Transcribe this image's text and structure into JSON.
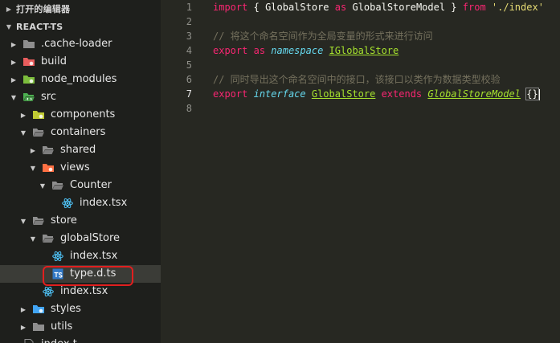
{
  "sidebar": {
    "open_editors": "打开的编辑器",
    "project": "REACT-TS",
    "tree": [
      {
        "label": ".cache-loader",
        "depth": 1,
        "arrow": "right",
        "icon": "folder-icon",
        "color": "#8e8e8e"
      },
      {
        "label": "build",
        "depth": 1,
        "arrow": "right",
        "icon": "folder-build-icon",
        "color": "#e85d5d"
      },
      {
        "label": "node_modules",
        "depth": 1,
        "arrow": "right",
        "icon": "folder-node-icon",
        "color": "#7cbd3c"
      },
      {
        "label": "src",
        "depth": 1,
        "arrow": "down",
        "icon": "folder-src-icon",
        "color": "#4caf50"
      },
      {
        "label": "components",
        "depth": 2,
        "arrow": "right",
        "icon": "folder-components-icon",
        "color": "#c0ca33"
      },
      {
        "label": "containers",
        "depth": 2,
        "arrow": "down",
        "icon": "folder-open-icon",
        "color": "#8e8e8e"
      },
      {
        "label": "shared",
        "depth": 3,
        "arrow": "right",
        "icon": "folder-open-icon",
        "color": "#8e8e8e"
      },
      {
        "label": "views",
        "depth": 3,
        "arrow": "down",
        "icon": "folder-views-icon",
        "color": "#ff7043"
      },
      {
        "label": "Counter",
        "depth": 4,
        "arrow": "down",
        "icon": "folder-open-icon",
        "color": "#8e8e8e"
      },
      {
        "label": "index.tsx",
        "depth": 5,
        "arrow": "none",
        "icon": "react-icon",
        "color": "#4fc3f7"
      },
      {
        "label": "store",
        "depth": 2,
        "arrow": "down",
        "icon": "folder-open-icon",
        "color": "#8e8e8e"
      },
      {
        "label": "globalStore",
        "depth": 3,
        "arrow": "down",
        "icon": "folder-open-icon",
        "color": "#8e8e8e"
      },
      {
        "label": "index.tsx",
        "depth": 4,
        "arrow": "none",
        "icon": "react-icon",
        "color": "#4fc3f7"
      },
      {
        "label": "type.d.ts",
        "depth": 4,
        "arrow": "none",
        "icon": "typescript-icon",
        "color": "#3178c6",
        "selected": true
      },
      {
        "label": "index.tsx",
        "depth": 3,
        "arrow": "none",
        "icon": "react-icon",
        "color": "#4fc3f7"
      },
      {
        "label": "styles",
        "depth": 2,
        "arrow": "right",
        "icon": "folder-styles-icon",
        "color": "#42a5f5"
      },
      {
        "label": "utils",
        "depth": 2,
        "arrow": "right",
        "icon": "folder-icon",
        "color": "#8e8e8e"
      },
      {
        "label": "index.t...",
        "depth": 1,
        "arrow": "none",
        "icon": "file-icon",
        "color": "#8e8e8e"
      }
    ]
  },
  "editor": {
    "line_numbers": [
      "1",
      "2",
      "3",
      "4",
      "5",
      "6",
      "7",
      "8"
    ],
    "active_line": "7",
    "line1": {
      "t1": "import",
      "t2": "{",
      "t3": "GlobalStore",
      "t4": "as",
      "t5": "GlobalStoreModel",
      "t6": "}",
      "t7": "from",
      "t8": "'./index'"
    },
    "line3": {
      "comment": "// 将这个命名空间作为全局变量的形式来进行访问"
    },
    "line4": {
      "t1": "export",
      "t2": "as",
      "t3": "namespace",
      "t4": "IGlobalStore"
    },
    "line6": {
      "comment": "// 同时导出这个命名空间中的接口，该接口以类作为数据类型校验"
    },
    "line7": {
      "t1": "export",
      "t2": "interface",
      "t3": "GlobalStore",
      "t4": "extends",
      "t5": "GlobalStoreModel",
      "t6": "{}"
    }
  }
}
